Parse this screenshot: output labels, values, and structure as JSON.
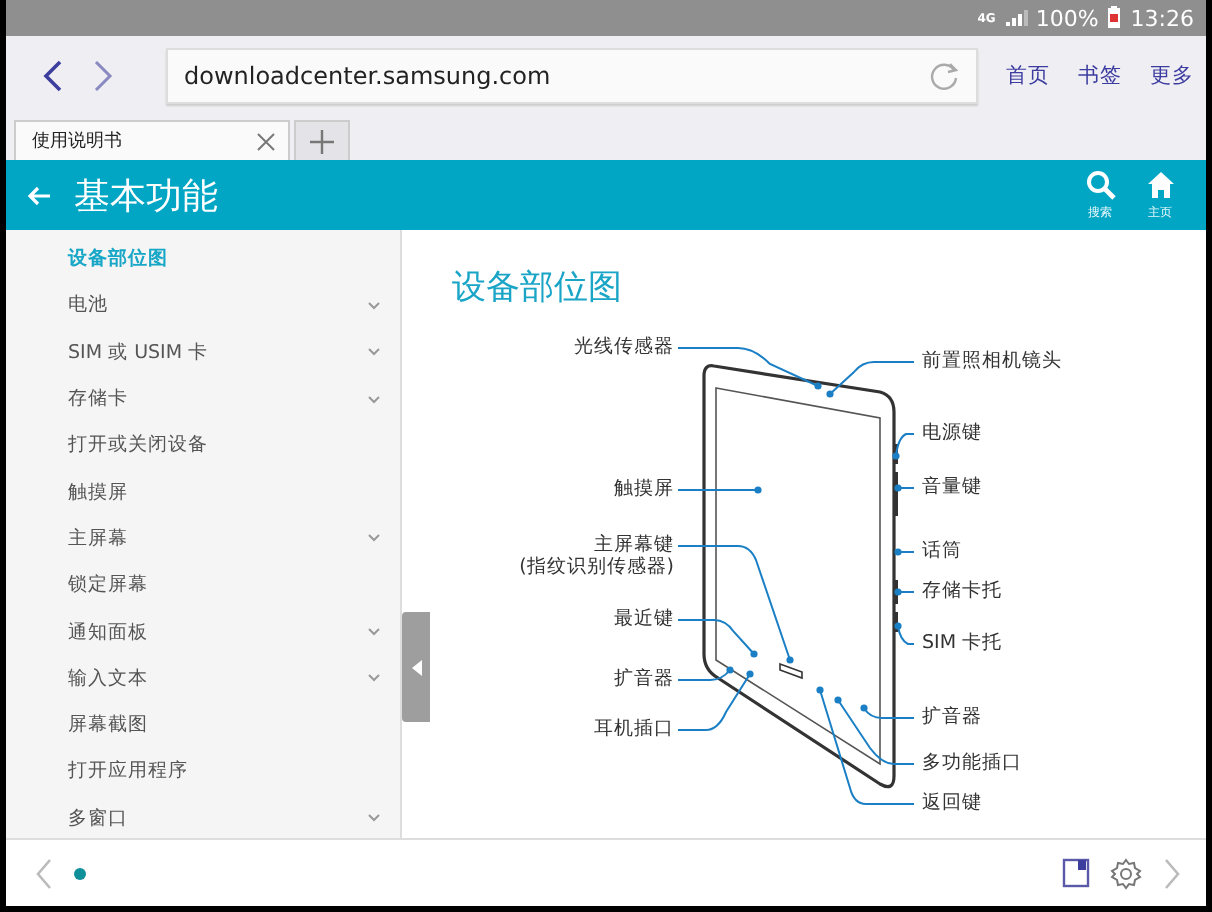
{
  "status_bar": {
    "network": "4G",
    "battery": "100%",
    "time": "13:26"
  },
  "browser": {
    "url": "downloadcenter.samsung.com",
    "links": [
      "首页",
      "书签",
      "更多"
    ],
    "tabs": [
      {
        "title": "使用说明书",
        "selected": true
      }
    ]
  },
  "header": {
    "title": "基本功能",
    "actions": [
      {
        "kind": "search",
        "label": "搜索"
      },
      {
        "kind": "home",
        "label": "主页"
      }
    ]
  },
  "sidebar": {
    "items": [
      {
        "label": "设备部位图",
        "selected": true,
        "expandable": false
      },
      {
        "label": "电池",
        "selected": false,
        "expandable": true
      },
      {
        "label": "SIM 或 USIM 卡",
        "selected": false,
        "expandable": true
      },
      {
        "label": "存储卡",
        "selected": false,
        "expandable": true
      },
      {
        "label": "打开或关闭设备",
        "selected": false,
        "expandable": false
      },
      {
        "label": "触摸屏",
        "selected": false,
        "expandable": false
      },
      {
        "label": "主屏幕",
        "selected": false,
        "expandable": true
      },
      {
        "label": "锁定屏幕",
        "selected": false,
        "expandable": false
      },
      {
        "label": "通知面板",
        "selected": false,
        "expandable": true
      },
      {
        "label": "输入文本",
        "selected": false,
        "expandable": true
      },
      {
        "label": "屏幕截图",
        "selected": false,
        "expandable": false
      },
      {
        "label": "打开应用程序",
        "selected": false,
        "expandable": false
      },
      {
        "label": "多窗口",
        "selected": false,
        "expandable": true
      }
    ]
  },
  "article": {
    "title": "设备部位图",
    "left_labels": [
      "光线传感器",
      "触摸屏",
      "主屏幕键\n(指纹识别传感器)",
      "最近键",
      "扩音器",
      "耳机插口"
    ],
    "right_labels": [
      "前置照相机镜头",
      "电源键",
      "音量键",
      "话筒",
      "存储卡托",
      "SIM 卡托",
      "扩音器",
      "多功能插口",
      "返回键"
    ]
  }
}
